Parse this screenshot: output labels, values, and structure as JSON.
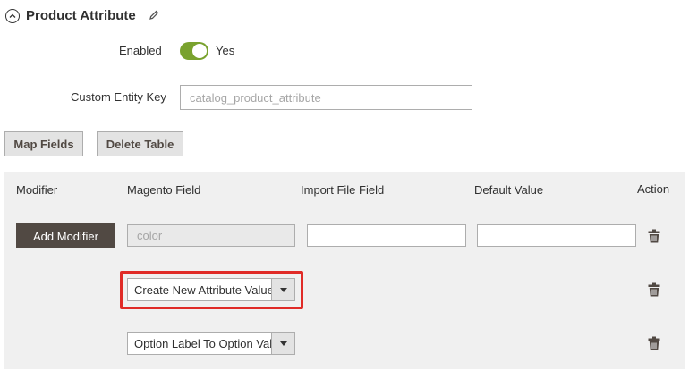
{
  "section": {
    "title": "Product Attribute",
    "toggle_icon": "chevron-up-circle-icon",
    "edit_icon": "pencil-icon"
  },
  "enabled": {
    "label": "Enabled",
    "state_text": "Yes",
    "toggle_color": "#79a22e"
  },
  "custom_entity_key": {
    "label": "Custom Entity Key",
    "placeholder": "catalog_product_attribute"
  },
  "actions": {
    "map_fields": "Map Fields",
    "delete_table": "Delete Table"
  },
  "grid": {
    "headers": {
      "modifier": "Modifier",
      "magento_field": "Magento Field",
      "import_file_field": "Import File Field",
      "default_value": "Default Value",
      "action": "Action"
    },
    "row1": {
      "add_modifier": "Add Modifier",
      "magento_field_placeholder": "color",
      "import_file_field_value": "",
      "default_value_value": ""
    },
    "modifiers": [
      {
        "selected": "Create New Attribute Value"
      },
      {
        "selected": "Option Label To Option Value"
      }
    ],
    "delete_icon": "trash-icon",
    "highlight_color": "#e02b27"
  }
}
